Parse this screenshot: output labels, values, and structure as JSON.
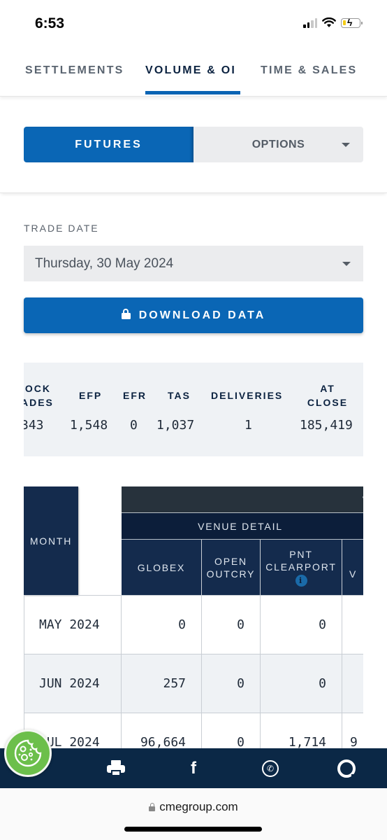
{
  "status_bar": {
    "time": "6:53",
    "signal_bars_on": 2,
    "signal_bars_total": 4,
    "battery_charging": true
  },
  "tabs": [
    {
      "label": "SETTLEMENTS",
      "active": false
    },
    {
      "label": "VOLUME & OI",
      "active": true
    },
    {
      "label": "TIME & SALES",
      "active": false
    }
  ],
  "product_type": {
    "futures_label": "FUTURES",
    "options_label": "OPTIONS",
    "selected": "FUTURES"
  },
  "trade_date": {
    "label": "TRADE DATE",
    "value": "Thursday, 30 May 2024"
  },
  "download_button": {
    "label": "DOWNLOAD DATA",
    "icon": "lock-icon"
  },
  "summary": {
    "columns": [
      {
        "header": ".OCK\nADES",
        "header_line1": ".OCK",
        "header_line2": "ADES",
        "value": "343"
      },
      {
        "header": "EFP",
        "value": "1,548"
      },
      {
        "header": "EFR",
        "value": "0"
      },
      {
        "header": "TAS",
        "value": "1,037"
      },
      {
        "header": "DELIVERIES",
        "value": "1"
      },
      {
        "header": "AT CLOSE",
        "header_line1": "AT",
        "header_line2": "CLOSE",
        "value": "185,419"
      }
    ]
  },
  "table": {
    "headers": {
      "month": "MONTH",
      "top_group": "V",
      "venue_group": "VENUE DETAIL",
      "globex": "GLOBEX",
      "open_outcry_line1": "OPEN",
      "open_outcry_line2": "OUTCRY",
      "pnt_line1": "PNT",
      "pnt_line2": "CLEARPORT",
      "pnt_info_icon": "i",
      "next_partial": "V"
    },
    "rows": [
      {
        "month": "MAY 2024",
        "globex": "0",
        "open_outcry": "0",
        "pnt_clearport": "0",
        "next": ""
      },
      {
        "month": "JUN 2024",
        "globex": "257",
        "open_outcry": "0",
        "pnt_clearport": "0",
        "next": ""
      },
      {
        "month": "JUL 2024",
        "globex": "96,664",
        "open_outcry": "0",
        "pnt_clearport": "1,714",
        "next": "9"
      }
    ]
  },
  "share_bar": {
    "icons": [
      "cookie-settings-icon",
      "printer-icon",
      "facebook-icon",
      "whatsapp-icon",
      "email-icon"
    ],
    "facebook_glyph": "f",
    "whatsapp_glyph": "✆"
  },
  "browser": {
    "url": "cmegroup.com"
  },
  "colors": {
    "accent_blue": "#0a66b5",
    "navy_header": "#142b4d",
    "dark_header": "#27323c",
    "share_bar": "#0b2846",
    "cookie_green": "#6cbf4b"
  }
}
